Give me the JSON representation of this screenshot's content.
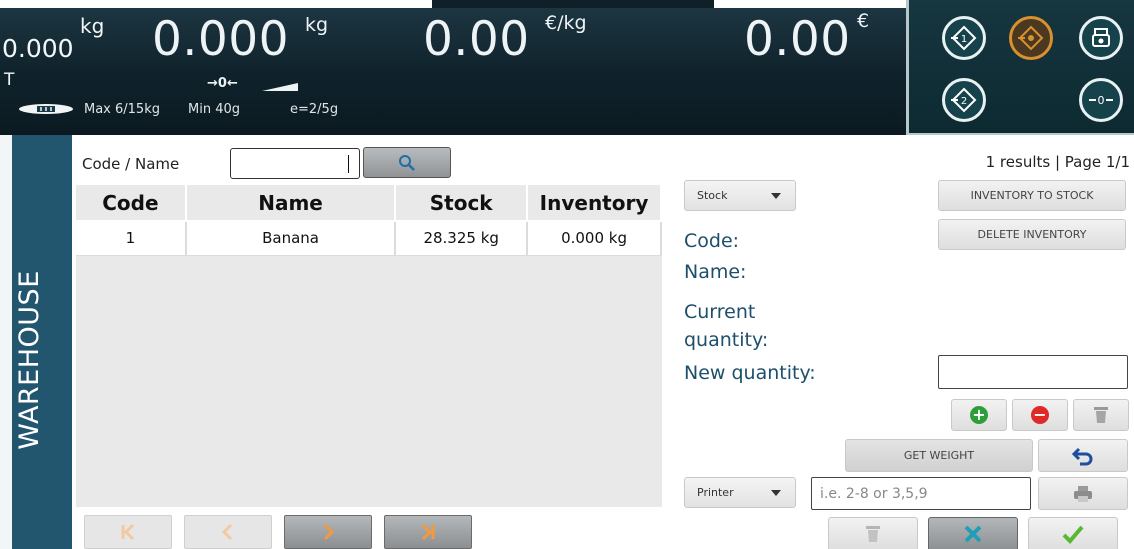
{
  "display": {
    "tare_value": "0.000",
    "tare_unit": "kg",
    "tare_flag": "T",
    "weight_value": "0.000",
    "weight_unit": "kg",
    "price_value": "0.00",
    "price_unit": "€/kg",
    "total_value": "0.00",
    "total_unit": "€",
    "zero_indicator": "→0←",
    "max_capacity": "Max 6/15kg",
    "min_capacity": "Min 40g",
    "division": "e=2/5g"
  },
  "scale_buttons": [
    {
      "icon": "plu-1-icon"
    },
    {
      "icon": "plu-orange-icon",
      "color": "#d9902d"
    },
    {
      "icon": "printer-scale-icon"
    },
    {
      "icon": "plu-2-icon"
    },
    {
      "icon": "zero-icon"
    }
  ],
  "sidebar": {
    "label": "WAREHOUSE"
  },
  "search": {
    "label": "Code / Name",
    "value": "",
    "button_icon": "search-icon"
  },
  "table": {
    "headers": [
      "Code",
      "Name",
      "Stock",
      "Inventory"
    ],
    "rows": [
      {
        "code": "1",
        "name": "Banana",
        "stock": "28.325 kg",
        "inventory": "0.000 kg"
      }
    ]
  },
  "pagination": {
    "summary": "1 results | Page 1/1",
    "buttons": [
      "first-page-icon",
      "prev-page-icon",
      "next-page-icon",
      "last-page-icon"
    ]
  },
  "detail": {
    "stock_select": "Stock",
    "inventory_to_stock": "INVENTORY TO STOCK",
    "delete_inventory": "DELETE INVENTORY",
    "code_label": "Code:",
    "name_label": "Name:",
    "current_qty_label_1": "Current",
    "current_qty_label_2": "quantity:",
    "new_qty_label": "New quantity:",
    "new_qty_value": "",
    "get_weight": "GET WEIGHT",
    "printer_select": "Printer",
    "range_placeholder": "i.e. 2-8 or 3,5,9"
  },
  "colors": {
    "accent_blue": "#22566f",
    "label_blue": "#1d4f6b",
    "add_green": "#2e9e3a",
    "remove_red": "#e02929",
    "cancel_teal": "#1f9fb5",
    "confirm_green": "#58b830",
    "pager_orange": "#f39a3d"
  }
}
